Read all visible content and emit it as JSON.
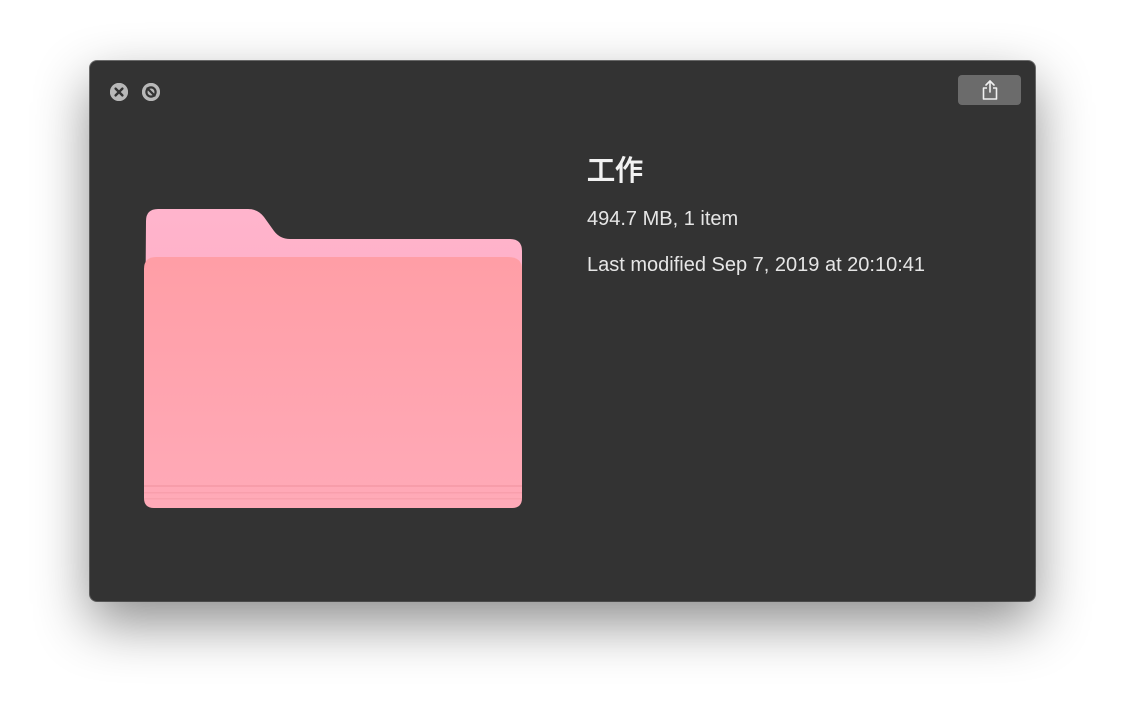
{
  "window": {
    "title": "工作",
    "size_summary": "494.7 MB, 1 item",
    "modified": "Last modified Sep 7, 2019 at 20:10:41"
  },
  "controls": {
    "close_icon": "close-icon",
    "fullscreen_icon": "fullscreen-icon",
    "share_icon": "share-icon"
  },
  "preview": {
    "icon": "folder-icon",
    "folder_color": "#ffa0aa",
    "tab_color": "#ffb0c6"
  },
  "colors": {
    "window_background": "#333333",
    "control_button": "#b4b4b4",
    "share_button": "#6b6b6b"
  }
}
